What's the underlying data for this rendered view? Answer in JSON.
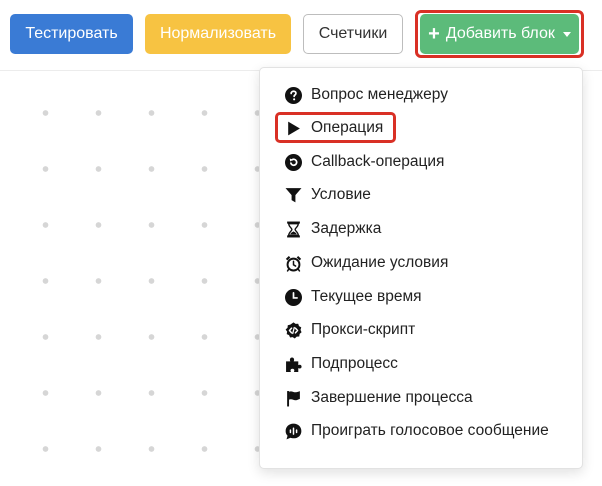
{
  "toolbar": {
    "test_label": "Тестировать",
    "normalize_label": "Нормализовать",
    "counters_label": "Счетчики",
    "add_block_label": "Добавить блок"
  },
  "menu": {
    "items": [
      {
        "label": "Вопрос менеджеру",
        "icon": "question-circle-icon"
      },
      {
        "label": "Операция",
        "icon": "play-icon"
      },
      {
        "label": "Callback-операция",
        "icon": "undo-circle-icon"
      },
      {
        "label": "Условие",
        "icon": "filter-icon"
      },
      {
        "label": "Задержка",
        "icon": "hourglass-icon"
      },
      {
        "label": "Ожидание условия",
        "icon": "alarm-clock-icon"
      },
      {
        "label": "Текущее время",
        "icon": "clock-icon"
      },
      {
        "label": "Прокси-скрипт",
        "icon": "code-badge-icon"
      },
      {
        "label": "Подпроцесс",
        "icon": "puzzle-icon"
      },
      {
        "label": "Завершение процесса",
        "icon": "flag-icon"
      },
      {
        "label": "Проиграть голосовое сообщение",
        "icon": "voice-message-icon"
      }
    ]
  },
  "colors": {
    "test": "#3a7bd5",
    "normalize": "#f7c342",
    "add_block": "#5cbb7a",
    "highlight": "#d93025"
  }
}
